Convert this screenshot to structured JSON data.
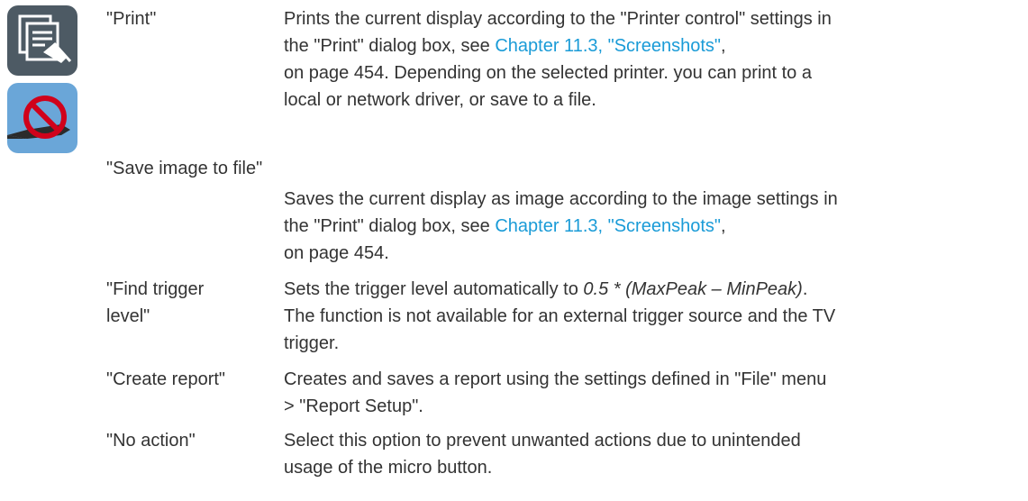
{
  "icons": {
    "print": {
      "name": "print-icon",
      "bg": "#4d5a64"
    },
    "no_action": {
      "name": "no-action-pen-icon",
      "bg": "#6aa6d8",
      "symbol": "#d0021b"
    }
  },
  "link_color": "#1a9bd7",
  "entries": {
    "print": {
      "term": "\"Print\"",
      "l1": "Prints the current display according to the \"Printer control\" settings in",
      "l2a": "the \"Print\" dialog box, see ",
      "l2link": "Chapter 11.3, \"Screenshots\"",
      "l2b": ",",
      "l3": "on page 454. Depending on the selected printer. you can print to a",
      "l4": "local or network driver, or save to a file."
    },
    "save": {
      "term": "\"Save image to file\"",
      "l1": "Saves the current display as image according to the image settings in",
      "l2a": "the \"Print\" dialog box, see ",
      "l2link": "Chapter 11.3, \"Screenshots\"",
      "l2b": ",",
      "l3": "on page 454."
    },
    "find": {
      "term1": "\"Find trigger",
      "term2": "level\"",
      "l1a": "Sets the trigger level automatically to ",
      "l1math": "0.5 * (MaxPeak – MinPeak)",
      "l1b": ".",
      "l2": "The function is not available for an external trigger source and the TV",
      "l3": "trigger."
    },
    "report": {
      "term": "\"Create report\"",
      "l1": "Creates and saves a report using the settings defined in \"File\" menu",
      "l2": "> \"Report Setup\"."
    },
    "noaction": {
      "term": "\"No action\"",
      "l1": "Select this option to prevent unwanted actions due to unintended",
      "l2": "usage of the micro button."
    }
  }
}
